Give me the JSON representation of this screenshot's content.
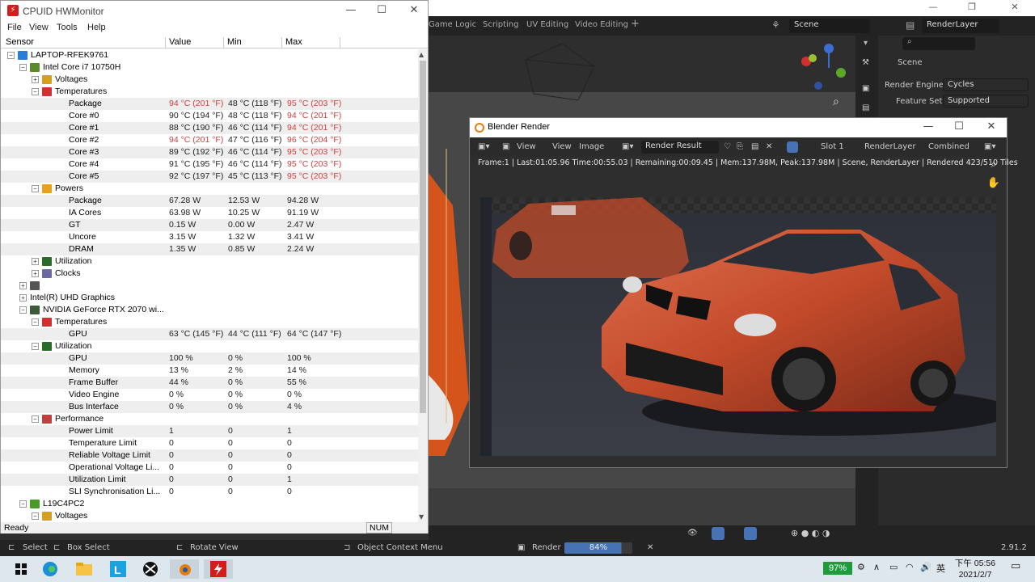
{
  "blender": {
    "workspaces": [
      "Game Logic",
      "Scripting",
      "UV Editing",
      "Video Editing"
    ],
    "scene": "Scene",
    "render_layer": "RenderLayer",
    "props": {
      "scene_label": "Scene",
      "render_engine_label": "Render Engine",
      "render_engine": "Cycles",
      "feature_set_label": "Feature Set",
      "feature_set": "Supported"
    },
    "status": {
      "select": "Select",
      "box_select": "Box Select",
      "rotate_view": "Rotate View",
      "context_menu": "Object Context Menu",
      "render_label": "Render",
      "render_progress": "84%",
      "render_progress_value": 84,
      "version": "2.91.2"
    }
  },
  "hwmonitor": {
    "title": "CPUID HWMonitor",
    "menu": [
      "File",
      "View",
      "Tools",
      "Help"
    ],
    "columns": [
      "Sensor",
      "Value",
      "Min",
      "Max"
    ],
    "rows": [
      {
        "label": "LAPTOP-RFEK9761",
        "value": "",
        "min": "",
        "max": "",
        "level": 0,
        "exp": "−",
        "icon": "#2a7fd4",
        "name": "computer-icon"
      },
      {
        "label": "Intel Core i7 10750H",
        "value": "",
        "min": "",
        "max": "",
        "level": 1,
        "exp": "−",
        "icon": "#5a8a2a",
        "name": "cpu-icon"
      },
      {
        "label": "Voltages",
        "value": "",
        "min": "",
        "max": "",
        "level": 2,
        "exp": "+",
        "icon": "#d4a020",
        "name": "voltage-icon"
      },
      {
        "label": "Temperatures",
        "value": "",
        "min": "",
        "max": "",
        "level": 2,
        "exp": "−",
        "icon": "#d03030",
        "name": "thermometer-icon"
      },
      {
        "label": "Package",
        "value": "94 °C (201 °F)",
        "min": "48 °C (118 °F)",
        "max": "95 °C (203 °F)",
        "level": 3,
        "red": [
          true,
          false,
          true
        ]
      },
      {
        "label": "Core #0",
        "value": "90 °C (194 °F)",
        "min": "48 °C (118 °F)",
        "max": "94 °C (201 °F)",
        "level": 3,
        "red": [
          false,
          false,
          true
        ]
      },
      {
        "label": "Core #1",
        "value": "88 °C (190 °F)",
        "min": "46 °C (114 °F)",
        "max": "94 °C (201 °F)",
        "level": 3,
        "red": [
          false,
          false,
          true
        ]
      },
      {
        "label": "Core #2",
        "value": "94 °C (201 °F)",
        "min": "47 °C (116 °F)",
        "max": "96 °C (204 °F)",
        "level": 3,
        "red": [
          true,
          false,
          true
        ]
      },
      {
        "label": "Core #3",
        "value": "89 °C (192 °F)",
        "min": "46 °C (114 °F)",
        "max": "95 °C (203 °F)",
        "level": 3,
        "red": [
          false,
          false,
          true
        ]
      },
      {
        "label": "Core #4",
        "value": "91 °C (195 °F)",
        "min": "46 °C (114 °F)",
        "max": "95 °C (203 °F)",
        "level": 3,
        "red": [
          false,
          false,
          true
        ]
      },
      {
        "label": "Core #5",
        "value": "92 °C (197 °F)",
        "min": "45 °C (113 °F)",
        "max": "95 °C (203 °F)",
        "level": 3,
        "red": [
          false,
          false,
          true
        ]
      },
      {
        "label": "Powers",
        "value": "",
        "min": "",
        "max": "",
        "level": 2,
        "exp": "−",
        "icon": "#e8a020",
        "name": "power-icon"
      },
      {
        "label": "Package",
        "value": "67.28 W",
        "min": "12.53 W",
        "max": "94.28 W",
        "level": 3
      },
      {
        "label": "IA Cores",
        "value": "63.98 W",
        "min": "10.25 W",
        "max": "91.19 W",
        "level": 3
      },
      {
        "label": "GT",
        "value": "0.15 W",
        "min": "0.00 W",
        "max": "2.47 W",
        "level": 3
      },
      {
        "label": "Uncore",
        "value": "3.15 W",
        "min": "1.32 W",
        "max": "3.41 W",
        "level": 3
      },
      {
        "label": "DRAM",
        "value": "1.35 W",
        "min": "0.85 W",
        "max": "2.24 W",
        "level": 3
      },
      {
        "label": "Utilization",
        "value": "",
        "min": "",
        "max": "",
        "level": 2,
        "exp": "+",
        "icon": "#2a6a2a",
        "name": "utilization-icon"
      },
      {
        "label": "Clocks",
        "value": "",
        "min": "",
        "max": "",
        "level": 2,
        "exp": "+",
        "icon": "#6a6aa0",
        "name": "clock-icon"
      },
      {
        "label": "",
        "value": "",
        "min": "",
        "max": "",
        "level": 1,
        "exp": "+",
        "icon": "#555555",
        "name": "drive-icon"
      },
      {
        "label": "Intel(R) UHD Graphics",
        "value": "",
        "min": "",
        "max": "",
        "level": 1,
        "exp": "+",
        "icon": "",
        "name": ""
      },
      {
        "label": "NVIDIA GeForce RTX 2070 wi...",
        "value": "",
        "min": "",
        "max": "",
        "level": 1,
        "exp": "−",
        "icon": "#3a5a3a",
        "name": "gpu-icon"
      },
      {
        "label": "Temperatures",
        "value": "",
        "min": "",
        "max": "",
        "level": 2,
        "exp": "−",
        "icon": "#d03030",
        "name": "thermometer-icon"
      },
      {
        "label": "GPU",
        "value": "63 °C (145 °F)",
        "min": "44 °C (111 °F)",
        "max": "64 °C (147 °F)",
        "level": 3
      },
      {
        "label": "Utilization",
        "value": "",
        "min": "",
        "max": "",
        "level": 2,
        "exp": "−",
        "icon": "#2a6a2a",
        "name": "utilization-icon"
      },
      {
        "label": "GPU",
        "value": "100 %",
        "min": "0 %",
        "max": "100 %",
        "level": 3
      },
      {
        "label": "Memory",
        "value": "13 %",
        "min": "2 %",
        "max": "14 %",
        "level": 3
      },
      {
        "label": "Frame Buffer",
        "value": "44 %",
        "min": "0 %",
        "max": "55 %",
        "level": 3
      },
      {
        "label": "Video Engine",
        "value": "0 %",
        "min": "0 %",
        "max": "0 %",
        "level": 3
      },
      {
        "label": "Bus Interface",
        "value": "0 %",
        "min": "0 %",
        "max": "4 %",
        "level": 3
      },
      {
        "label": "Performance",
        "value": "",
        "min": "",
        "max": "",
        "level": 2,
        "exp": "−",
        "icon": "#c04040",
        "name": "performance-icon"
      },
      {
        "label": "Power Limit",
        "value": "1",
        "min": "0",
        "max": "1",
        "level": 3
      },
      {
        "label": "Temperature Limit",
        "value": "0",
        "min": "0",
        "max": "0",
        "level": 3
      },
      {
        "label": "Reliable Voltage Limit",
        "value": "0",
        "min": "0",
        "max": "0",
        "level": 3
      },
      {
        "label": "Operational Voltage Li...",
        "value": "0",
        "min": "0",
        "max": "0",
        "level": 3
      },
      {
        "label": "Utilization Limit",
        "value": "0",
        "min": "0",
        "max": "1",
        "level": 3
      },
      {
        "label": "SLI Synchronisation Li...",
        "value": "0",
        "min": "0",
        "max": "0",
        "level": 3
      },
      {
        "label": "L19C4PC2",
        "value": "",
        "min": "",
        "max": "",
        "level": 1,
        "exp": "−",
        "icon": "#4a9a2a",
        "name": "battery-icon"
      },
      {
        "label": "Voltages",
        "value": "",
        "min": "",
        "max": "",
        "level": 2,
        "exp": "−",
        "icon": "#d4a020",
        "name": "voltage-icon"
      }
    ],
    "status": {
      "ready": "Ready",
      "num": "NUM"
    }
  },
  "render_window": {
    "title": "Blender Render",
    "toolbar": {
      "view_menu": "View",
      "view": "View",
      "image": "Image",
      "image_name": "Render Result",
      "slot": "Slot 1",
      "layer": "RenderLayer",
      "pass": "Combined"
    },
    "info": "Frame:1 | Last:01:05.96 Time:00:55.03 | Remaining:00:09.45 | Mem:137.98M, Peak:137.98M | Scene, RenderLayer | Rendered 423/510 Tiles"
  },
  "taskbar": {
    "battery": "97%",
    "ime": "英",
    "time": "下午 05:56",
    "date": "2021/2/7"
  }
}
